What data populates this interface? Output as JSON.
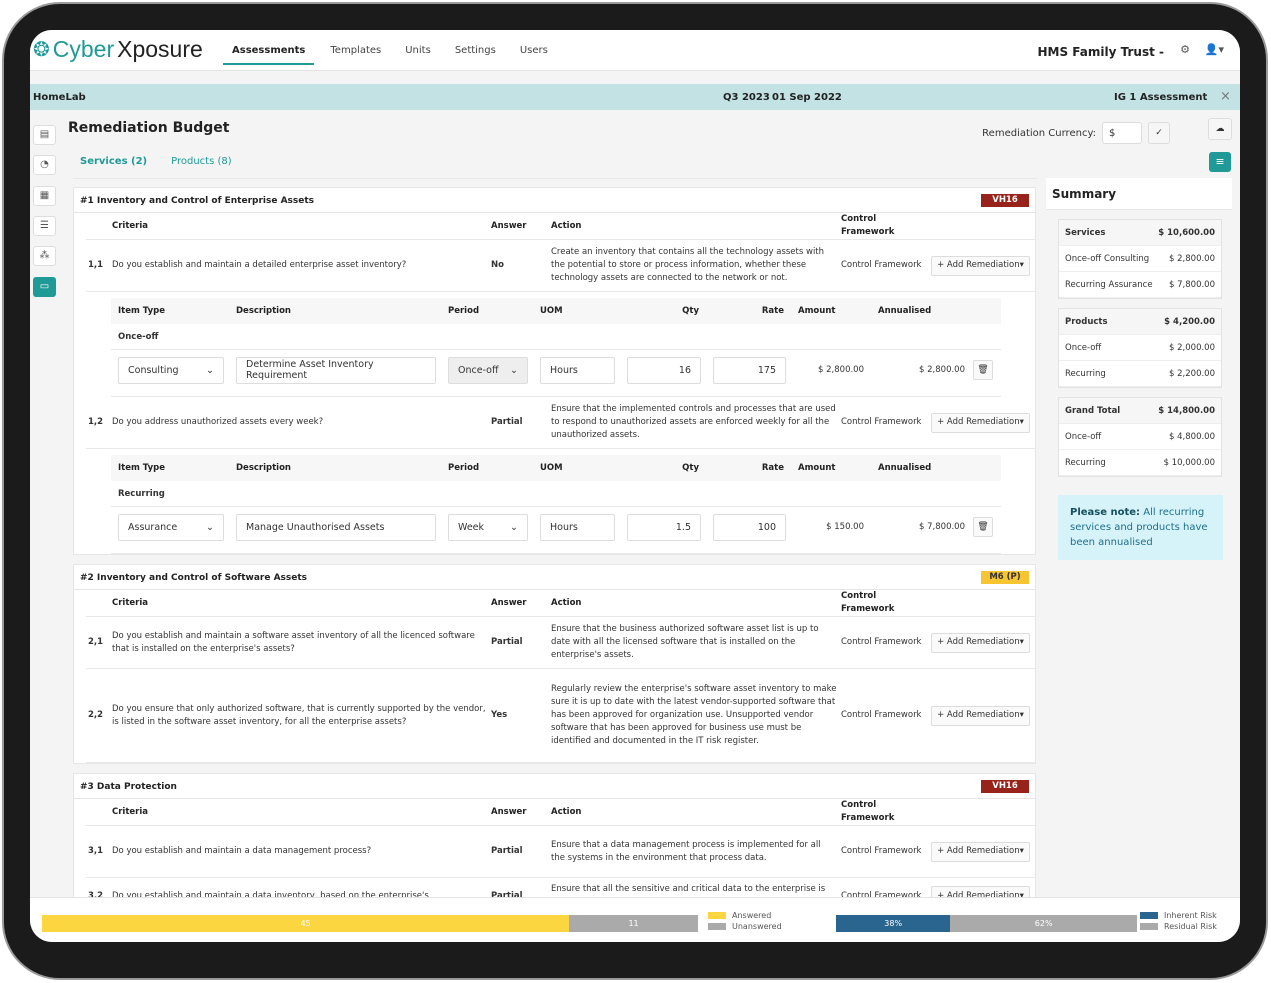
{
  "app": {
    "logo_cyber": "Cyber",
    "logo_xposure": "Xposure",
    "nav": [
      "Assessments",
      "Templates",
      "Units",
      "Settings",
      "Users"
    ],
    "active_nav": "Assessments",
    "org": "HMS Family Trust -",
    "settings_icon": "gear-icon",
    "user_icon": "user-icon"
  },
  "banner": {
    "unit": "HomeLab",
    "period": "Q3 2023",
    "date": "01 Sep 2022",
    "assessment": "IG 1 Assessment",
    "close": "×"
  },
  "sidebar_icons": [
    "servers-icon",
    "chart-pie-icon",
    "grid-icon",
    "list-icon",
    "cubes-icon",
    "budget-icon"
  ],
  "page": {
    "title": "Remediation Budget",
    "currency_label": "Remediation Currency:",
    "currency_value": "$",
    "tabs": [
      "Services (2)",
      "Products (8)"
    ]
  },
  "headers": {
    "criteria": "Criteria",
    "answer": "Answer",
    "action": "Action",
    "cf": "Control Framework",
    "item_type": "Item Type",
    "description": "Description",
    "period": "Period",
    "uom": "UOM",
    "qty": "Qty",
    "rate": "Rate",
    "amount": "Amount",
    "annualised": "Annualised",
    "add": "+ Add Remediation"
  },
  "sections": [
    {
      "title": "#1 Inventory and Control of Enterprise Assets",
      "badge": "VH16",
      "rows": [
        {
          "num": "1,1",
          "criteria": "Do you establish and maintain a detailed enterprise asset inventory?",
          "answer": "No",
          "action": "Create an inventory that contains all the technology assets with the potential to store or process information, whether these technology assets are connected to the network or not.",
          "cf": "Control Framework",
          "sub": {
            "group": "Once-off",
            "item_type": "Consulting",
            "description": "Determine Asset Inventory Requirement",
            "period": "Once-off",
            "uom": "Hours",
            "qty": "16",
            "rate": "175",
            "amount": "$ 2,800.00",
            "annualised": "$ 2,800.00"
          }
        },
        {
          "num": "1,2",
          "criteria": "Do you address unauthorized assets every week?",
          "answer": "Partial",
          "action": "Ensure that the implemented controls and processes that are used to respond to unauthorized assets are enforced weekly for all the unauthorized assets.",
          "cf": "Control Framework",
          "sub": {
            "group": "Recurring",
            "item_type": "Assurance",
            "description": "Manage Unauthorised Assets",
            "period": "Week",
            "uom": "Hours",
            "qty": "1.5",
            "rate": "100",
            "amount": "$ 150.00",
            "annualised": "$ 7,800.00"
          }
        }
      ]
    },
    {
      "title": "#2 Inventory and Control of Software Assets",
      "badge": "M6 (P)",
      "rows": [
        {
          "num": "2,1",
          "criteria": "Do you establish and maintain a software asset inventory of all the licenced software that is installed on the enterprise's assets?",
          "answer": "Partial",
          "action": "Ensure that the business authorized software asset list is up to date with all the licensed software that is installed on the enterprise's assets.",
          "cf": "Control Framework"
        },
        {
          "num": "2,2",
          "criteria": "Do you ensure that only authorized software, that is currently supported by the vendor, is listed in the software asset inventory, for all the enterprise assets?",
          "answer": "Yes",
          "action": "Regularly review the enterprise's software asset inventory to make sure it is up to date with the latest vendor-supported software that has been approved for organization use. Unsupported vendor software that has been approved for business use must be identified and documented in the IT risk register.",
          "cf": "Control Framework"
        }
      ]
    },
    {
      "title": "#3 Data Protection",
      "badge": "VH16",
      "rows": [
        {
          "num": "3,1",
          "criteria": "Do you establish and maintain a data management process?",
          "answer": "Partial",
          "action": "Ensure that a data management process is implemented for all the systems in the environment that process data.",
          "cf": "Control Framework"
        },
        {
          "num": "3,2",
          "criteria": "Do you establish and maintain a data inventory, based on the enterprise's",
          "answer": "Partial",
          "action": "Ensure that all the sensitive and critical data to the enterprise is inventoried regardless of whether that data is located on-site or",
          "cf": "Control Framework"
        }
      ]
    }
  ],
  "summary": {
    "title": "Summary",
    "groups": [
      {
        "label": "Services",
        "total": "$ 10,600.00",
        "items": [
          [
            "Once-off Consulting",
            "$ 2,800.00"
          ],
          [
            "Recurring Assurance",
            "$ 7,800.00"
          ]
        ]
      },
      {
        "label": "Products",
        "total": "$ 4,200.00",
        "items": [
          [
            "Once-off",
            "$ 2,000.00"
          ],
          [
            "Recurring",
            "$ 2,200.00"
          ]
        ]
      },
      {
        "label": "Grand Total",
        "total": "$ 14,800.00",
        "items": [
          [
            "Once-off",
            "$ 4,800.00"
          ],
          [
            "Recurring",
            "$ 10,000.00"
          ]
        ]
      }
    ],
    "note_bold": "Please note:",
    "note": " All recurring services and products have been annualised"
  },
  "progress": {
    "answered": 45,
    "unanswered": 11,
    "answered_label": "Answered",
    "unanswered_label": "Unanswered",
    "answered_color": "#fcd641",
    "unanswered_color": "#aaaaaa"
  },
  "risk": {
    "inherent": "38%",
    "residual": "62%",
    "inherent_value": 38,
    "residual_value": 62,
    "inherent_label": "Inherent Risk",
    "residual_label": "Residual Risk",
    "inherent_color": "#2a6590",
    "residual_color": "#aaaaaa"
  }
}
